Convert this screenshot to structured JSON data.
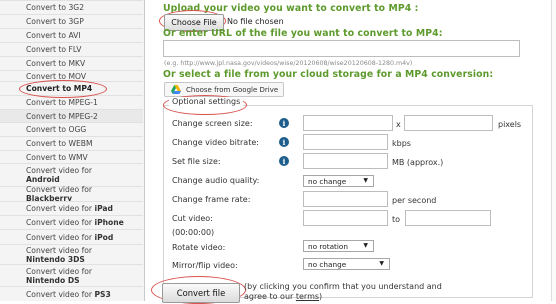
{
  "sidebar": {
    "items": [
      {
        "line1": "Convert to 3G2",
        "line2": "",
        "style": "plain"
      },
      {
        "line1": "Convert to 3GP",
        "line2": "",
        "style": "plain"
      },
      {
        "line1": "Convert to AVI",
        "line2": "",
        "style": "plain"
      },
      {
        "line1": "Convert to FLV",
        "line2": "",
        "style": "plain"
      },
      {
        "line1": "Convert to MKV",
        "line2": "",
        "style": "plain"
      },
      {
        "line1": "Convert to MOV",
        "line2": "",
        "style": "plain"
      },
      {
        "line1": "Convert to MP4",
        "line2": "",
        "style": "selected"
      },
      {
        "line1": "Convert to MPEG-1",
        "line2": "",
        "style": "plain"
      },
      {
        "line1": "Convert to MPEG-2",
        "line2": "",
        "style": "dark"
      },
      {
        "line1": "Convert to OGG",
        "line2": "",
        "style": "plain"
      },
      {
        "line1": "Convert to WEBM",
        "line2": "",
        "style": "plain"
      },
      {
        "line1": "Convert to WMV",
        "line2": "",
        "style": "plain"
      },
      {
        "line1": "Convert video for",
        "line2": "Android",
        "style": "plain"
      },
      {
        "line1": "Convert video for",
        "line2": "Blackberry",
        "style": "plain"
      },
      {
        "line1": "Convert video for",
        "line2": "iPad",
        "style": "inline"
      },
      {
        "line1": "Convert video for",
        "line2": "iPhone",
        "style": "inline"
      },
      {
        "line1": "Convert video for",
        "line2": "iPod",
        "style": "inline"
      },
      {
        "line1": "Convert video for",
        "line2": "Nintendo 3DS",
        "style": "plain"
      },
      {
        "line1": "Convert video for",
        "line2": "Nintendo DS",
        "style": "plain"
      },
      {
        "line1": "Convert video for",
        "line2": "PS3",
        "style": "inline"
      }
    ]
  },
  "upload": {
    "heading": "Upload your video you want to convert to MP4 :",
    "choose_button": "Choose File",
    "no_file": "No file chosen"
  },
  "url": {
    "heading": "Or enter URL of the file you want to convert to MP4:",
    "value": "",
    "example": "(e.g. http://www.jpl.nasa.gov/videos/wise/20120608/wise20120608-1280.m4v)"
  },
  "cloud": {
    "heading": "Or select a file from your cloud storage for a MP4 conversion:",
    "gdrive_button": "Choose from Google Drive"
  },
  "options": {
    "legend": "Optional settings",
    "screen_size_label": "Change screen size:",
    "screen_size_x": "x",
    "screen_size_unit": "pixels",
    "bitrate_label": "Change video bitrate:",
    "bitrate_unit": "kbps",
    "file_size_label": "Set file size:",
    "file_size_unit": "MB (approx.)",
    "audio_label": "Change audio quality:",
    "audio_value": "no change",
    "frame_rate_label": "Change frame rate:",
    "frame_rate_unit": "per second",
    "cut_label": "Cut video:",
    "cut_to": "to",
    "cut_hint": "(00:00:00)",
    "rotate_label": "Rotate video:",
    "rotate_value": "no rotation",
    "mirror_label": "Mirror/flip video:",
    "mirror_value": "no change"
  },
  "convert": {
    "button": "Convert file",
    "terms_before": "(by clicking you confirm that you understand and agree to our ",
    "terms_link": "terms",
    "terms_after": ")"
  },
  "colors": {
    "heading_green": "#5d9a2c",
    "annotation_red": "#d9534f",
    "info_blue": "#1f5e8c"
  }
}
